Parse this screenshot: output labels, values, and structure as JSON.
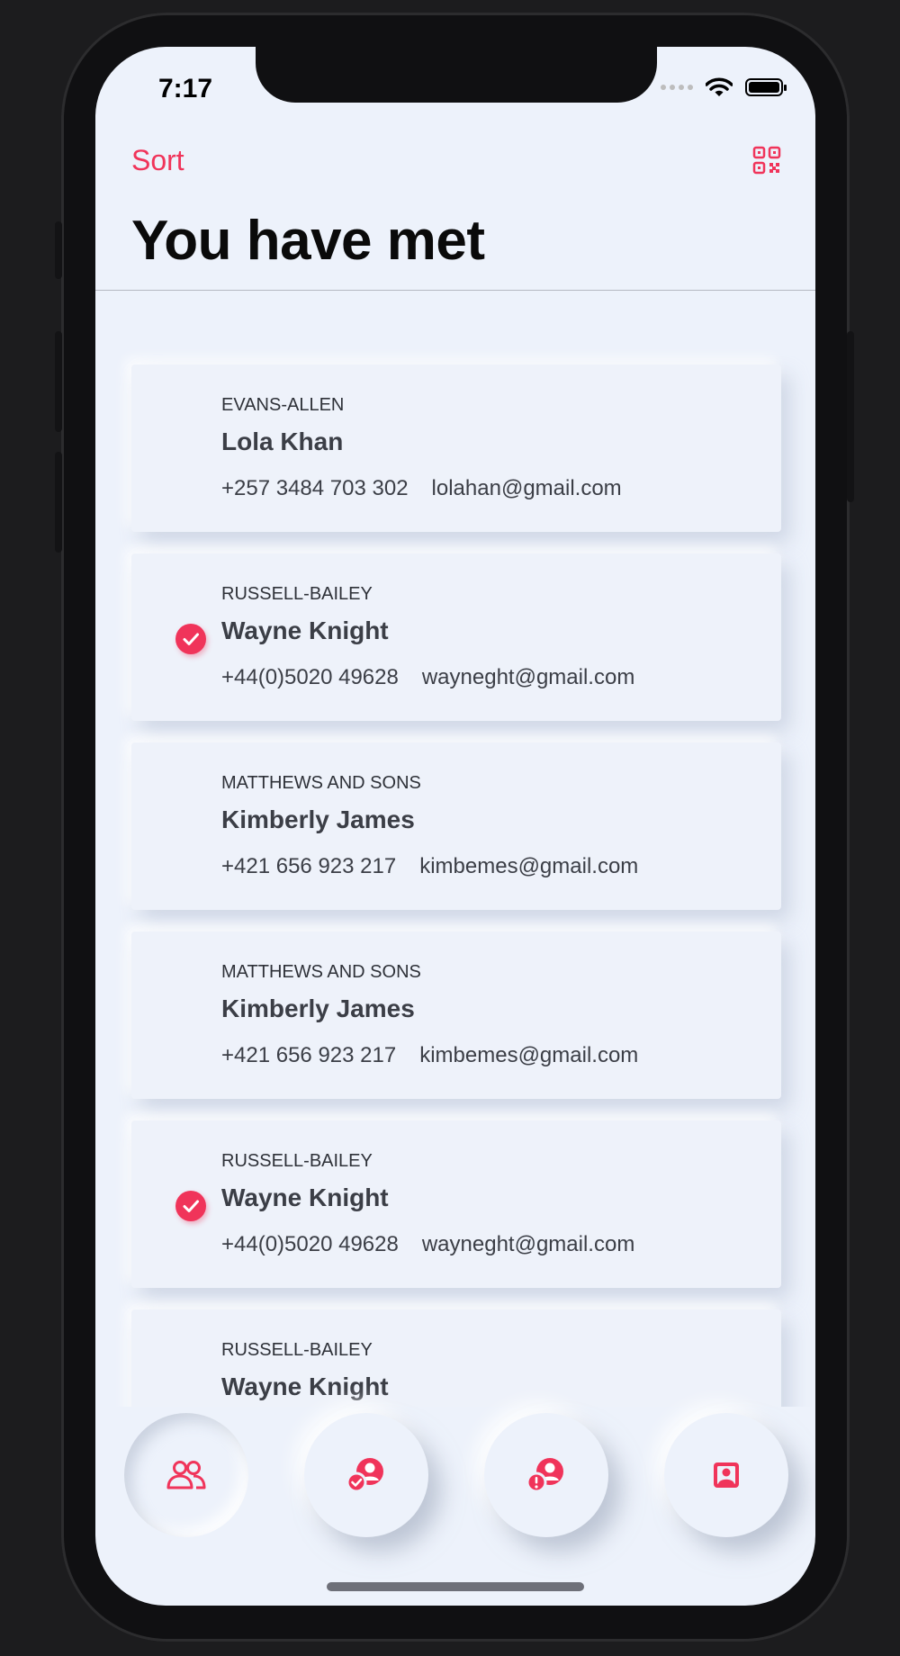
{
  "status_bar": {
    "time": "7:17"
  },
  "header": {
    "sort_label": "Sort",
    "title": "You have met"
  },
  "contacts": [
    {
      "company": "EVANS-ALLEN",
      "name": "Lola Khan",
      "phone": "+257 3484 703 302",
      "email": "lolahan@gmail.com",
      "checked": false
    },
    {
      "company": "RUSSELL-BAILEY",
      "name": "Wayne Knight",
      "phone": "+44(0)5020 49628",
      "email": "wayneght@gmail.com",
      "checked": true
    },
    {
      "company": "MATTHEWS AND SONS",
      "name": "Kimberly James",
      "phone": "+421 656 923 217",
      "email": "kimbemes@gmail.com",
      "checked": false
    },
    {
      "company": "MATTHEWS AND SONS",
      "name": "Kimberly James",
      "phone": "+421 656 923 217",
      "email": "kimbemes@gmail.com",
      "checked": false
    },
    {
      "company": "RUSSELL-BAILEY",
      "name": "Wayne Knight",
      "phone": "+44(0)5020 49628",
      "email": "wayneght@gmail.com",
      "checked": true
    },
    {
      "company": "RUSSELL-BAILEY",
      "name": "Wayne Knight",
      "phone": "",
      "email": "",
      "checked": false
    }
  ],
  "tab_bar": [
    {
      "icon": "people-icon",
      "active": true
    },
    {
      "icon": "user-check-icon",
      "active": false
    },
    {
      "icon": "user-alert-icon",
      "active": false
    },
    {
      "icon": "contact-card-icon",
      "active": false
    }
  ],
  "colors": {
    "accent": "#f0345a",
    "background": "#edf2fb",
    "text": "#3b3e46"
  }
}
